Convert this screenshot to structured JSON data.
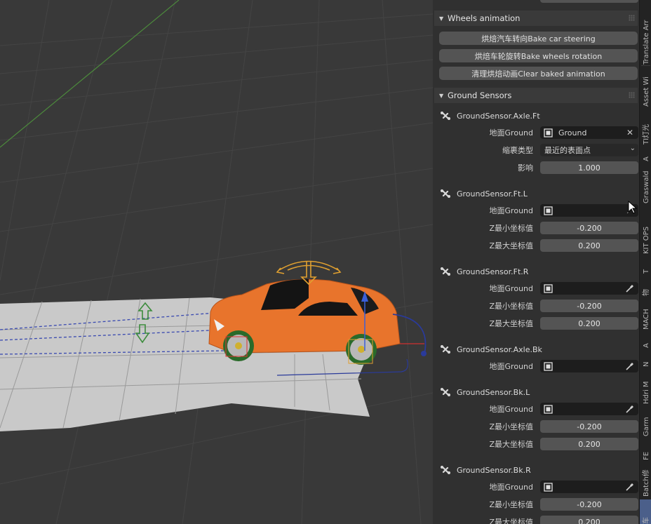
{
  "viewport": {
    "body_color": "#e8742c",
    "gizmo_color": "#e0a030",
    "axis_colors": {
      "x": "#c0d0e0",
      "y": "#4c8a3c",
      "z": "#3a5fd8"
    }
  },
  "panel": {
    "wheels_section": {
      "title": "Wheels animation",
      "buttons": [
        "烘焙汽车转向Bake car steering",
        "烘焙车轮旋转Bake wheels rotation",
        "清理烘焙动画Clear baked animation"
      ]
    },
    "sensors_section": {
      "title": "Ground Sensors",
      "sensors": [
        {
          "name": "GroundSensor.Axle.Ft",
          "ground_label": "地面Ground",
          "ground_value": "Ground",
          "shrink_label": "缩裹类型",
          "shrink_value": "最近的表面点",
          "influence_label": "影响",
          "influence_value": "1.000"
        },
        {
          "name": "GroundSensor.Ft.L",
          "ground_label": "地面Ground",
          "zmin_label": "Z最小坐标值",
          "zmin": "-0.200",
          "zmax_label": "Z最大坐标值",
          "zmax": "0.200"
        },
        {
          "name": "GroundSensor.Ft.R",
          "ground_label": "地面Ground",
          "zmin_label": "Z最小坐标值",
          "zmin": "-0.200",
          "zmax_label": "Z最大坐标值",
          "zmax": "0.200"
        },
        {
          "name": "GroundSensor.Axle.Bk",
          "ground_label": "地面Ground"
        },
        {
          "name": "GroundSensor.Bk.L",
          "ground_label": "地面Ground",
          "zmin_label": "Z最小坐标值",
          "zmin": "-0.200",
          "zmax_label": "Z最大坐标值",
          "zmax": "0.200"
        },
        {
          "name": "GroundSensor.Bk.R",
          "ground_label": "地面Ground",
          "zmin_label": "Z最小坐标值",
          "zmin": "-0.200",
          "zmax_label": "Z最大坐标值",
          "zmax": "0.200"
        }
      ]
    }
  },
  "sidebar_tabs": [
    "Translate Arr",
    "Asset Wi",
    "TI灯光",
    "A",
    "Graswald",
    "KIT OPS",
    "T",
    "物",
    "MACH",
    "A",
    "N",
    "Hdri M",
    "Garm",
    "FE",
    "Batch修",
    "车"
  ],
  "icons": {
    "collapse": "triangle-down-icon",
    "bone": "bone-icon",
    "object": "object-icon",
    "clear": "x-icon",
    "eyedropper": "eyedropper-icon",
    "chevron": "chevron-down-icon"
  }
}
